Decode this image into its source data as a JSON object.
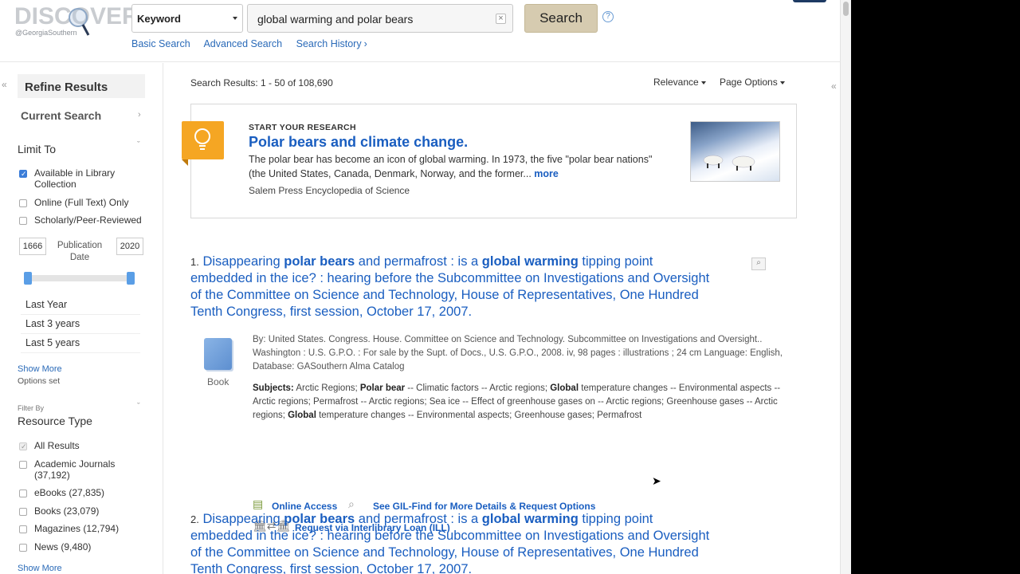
{
  "header": {
    "logo_text": "DISCOVER",
    "logo_sub": "@GeorgiaSouthern",
    "field_select": "Keyword",
    "search_value": "global warming and polar bears",
    "clear_icon": "×",
    "search_button": "Search",
    "help_icon": "?",
    "links": [
      "Basic Search",
      "Advanced Search",
      "Search History"
    ]
  },
  "sidebar": {
    "collapse_icon": "«",
    "refine_title": "Refine Results",
    "current_search": "Current Search",
    "current_search_arrow": "›",
    "limit_to": "Limit To",
    "limit_arrow": "ˇ",
    "limits": [
      {
        "label": "Available in Library Collection",
        "checked": true
      },
      {
        "label": "Online (Full Text) Only",
        "checked": false
      },
      {
        "label": "Scholarly/Peer-Reviewed",
        "checked": false
      }
    ],
    "year_from": "1666",
    "year_to": "2020",
    "publication_date": "Publication Date",
    "date_ranges": [
      "Last Year",
      "Last 3 years",
      "Last 5 years"
    ],
    "show_more_1": "Show More",
    "options_set": "Options set",
    "filter_by": "Filter By",
    "resource_type": "Resource Type",
    "resource_arrow": "ˇ",
    "resources": [
      {
        "label": "All Results",
        "checked": true
      },
      {
        "label": "Academic Journals (37,192)",
        "checked": false
      },
      {
        "label": "eBooks (27,835)",
        "checked": false
      },
      {
        "label": "Books (23,079)",
        "checked": false
      },
      {
        "label": "Magazines (12,794)",
        "checked": false
      },
      {
        "label": "News (9,480)",
        "checked": false
      }
    ],
    "show_more_2": "Show More"
  },
  "main": {
    "results_count": "Search Results: 1 - 50 of 108,690",
    "sort_relevance": "Relevance",
    "page_options": "Page Options",
    "collapse_right": "«",
    "research": {
      "kicker": "START YOUR RESEARCH",
      "title": "Polar bears and climate change.",
      "text": "The polar bear has become an icon of global warming. In 1973, the five \"polar bear nations\" (the United States, Canada, Denmark, Norway, and the former...",
      "more": "more",
      "source": "Salem Press Encyclopedia of Science"
    },
    "results": [
      {
        "num": "1.",
        "title_parts": [
          "Disappearing ",
          "polar bears",
          " and permafrost : is a ",
          "global warming",
          " tipping point embedded in the ice? : hearing before the Subcommittee on Investigations and Oversight of the Committee on Science and Technology, House of Representatives, One Hundred Tenth Congress, first session, October 17, 2007."
        ],
        "type": "Book",
        "meta": "By: United States. Congress. House. Committee on Science and Technology. Subcommittee on Investigations and Oversight.. Washington : U.S. G.P.O. : For sale by the Supt. of Docs., U.S. G.P.O., 2008. iv, 98 pages : illustrations ; 24 cm Language: English, Database: GASouthern Alma Catalog",
        "subjects_label": "Subjects:",
        "subjects_parts": [
          " Arctic Regions; ",
          "Polar bear",
          " -- Climatic factors -- Arctic regions; ",
          "Global",
          " temperature changes -- Environmental aspects -- Arctic regions; Permafrost -- Arctic regions; Sea ice -- Effect of greenhouse gases on -- Arctic regions; Greenhouse gases -- Arctic regions; ",
          "Global",
          " temperature changes -- Environmental aspects; Greenhouse gases; Permafrost"
        ],
        "online_access": "Online Access",
        "gil_find": "See GIL-Find for More Details & Request Options",
        "ill": "Request via Interlibrary Loan (ILL)"
      },
      {
        "num": "2.",
        "title_parts": [
          "Disappearing ",
          "polar bears",
          " and permafrost : is a ",
          "global warming",
          " tipping point embedded in the ice? : hearing before the Subcommittee on Investigations and Oversight of the Committee on Science and Technology, House of Representatives, One Hundred Tenth Congress, first session, October 17, 2007."
        ]
      }
    ]
  },
  "colors": {
    "link": "#1a5ec0",
    "search_button": "#d6cbb0",
    "bulb": "#f5a623",
    "checkbox": "#3b7dd8"
  }
}
